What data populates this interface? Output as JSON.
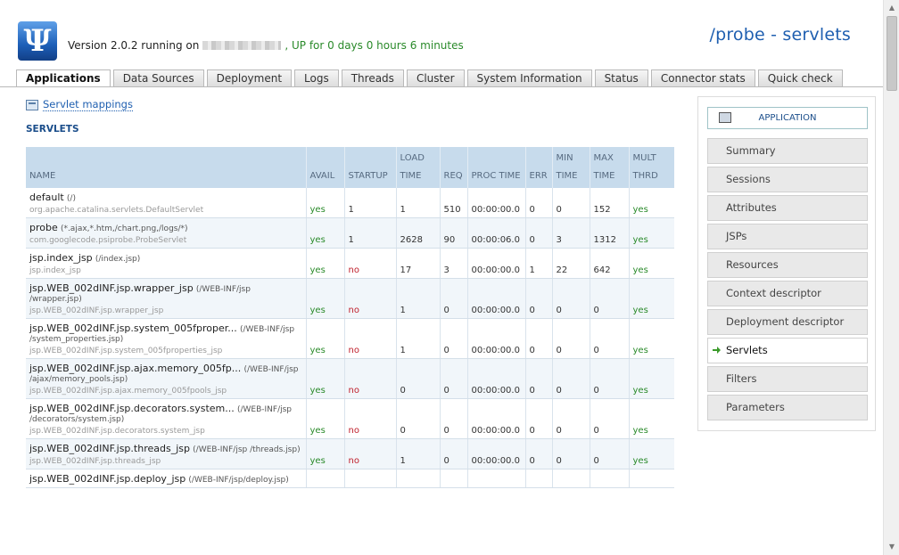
{
  "header": {
    "logo_glyph": "Ψ",
    "version_text": "Version 2.0.2 running on",
    "uptime_text": ", UP for 0 days 0 hours 6 minutes",
    "page_title": "/probe - servlets"
  },
  "tabs": [
    {
      "label": "Applications",
      "active": true
    },
    {
      "label": "Data Sources",
      "active": false
    },
    {
      "label": "Deployment",
      "active": false
    },
    {
      "label": "Logs",
      "active": false
    },
    {
      "label": "Threads",
      "active": false
    },
    {
      "label": "Cluster",
      "active": false
    },
    {
      "label": "System Information",
      "active": false
    },
    {
      "label": "Status",
      "active": false
    },
    {
      "label": "Connector stats",
      "active": false
    },
    {
      "label": "Quick check",
      "active": false
    }
  ],
  "main": {
    "mappings_link": "Servlet mappings",
    "section_title": "SERVLETS",
    "columns": [
      "NAME",
      "AVAIL",
      "STARTUP",
      "LOAD TIME",
      "REQ",
      "PROC TIME",
      "ERR",
      "MIN TIME",
      "MAX TIME",
      "MULT THRD"
    ],
    "rows": [
      {
        "name": "default",
        "mapping": "(/)",
        "cls": "org.apache.catalina.servlets.DefaultServlet",
        "avail": "yes",
        "startup": "1",
        "load": "1",
        "req": "510",
        "proc": "00:00:00.0",
        "err": "0",
        "min": "0",
        "max": "152",
        "mult": "yes"
      },
      {
        "name": "probe",
        "mapping": "(*.ajax,*.htm,/chart.png,/logs/*)",
        "cls": "com.googlecode.psiprobe.ProbeServlet",
        "avail": "yes",
        "startup": "1",
        "load": "2628",
        "req": "90",
        "proc": "00:00:06.0",
        "err": "0",
        "min": "3",
        "max": "1312",
        "mult": "yes"
      },
      {
        "name": "jsp.index_jsp",
        "mapping": "(/index.jsp)",
        "cls": "jsp.index_jsp",
        "avail": "yes",
        "startup": "no",
        "load": "17",
        "req": "3",
        "proc": "00:00:00.0",
        "err": "1",
        "min": "22",
        "max": "642",
        "mult": "yes"
      },
      {
        "name": "jsp.WEB_002dINF.jsp.wrapper_jsp",
        "mapping": "(/WEB-INF/jsp /wrapper.jsp)",
        "cls": "jsp.WEB_002dINF.jsp.wrapper_jsp",
        "avail": "yes",
        "startup": "no",
        "load": "1",
        "req": "0",
        "proc": "00:00:00.0",
        "err": "0",
        "min": "0",
        "max": "0",
        "mult": "yes"
      },
      {
        "name": "jsp.WEB_002dINF.jsp.system_005fproper...",
        "mapping": "(/WEB-INF/jsp /system_properties.jsp)",
        "cls": "jsp.WEB_002dINF.jsp.system_005fproperties_jsp",
        "avail": "yes",
        "startup": "no",
        "load": "1",
        "req": "0",
        "proc": "00:00:00.0",
        "err": "0",
        "min": "0",
        "max": "0",
        "mult": "yes"
      },
      {
        "name": "jsp.WEB_002dINF.jsp.ajax.memory_005fp...",
        "mapping": "(/WEB-INF/jsp /ajax/memory_pools.jsp)",
        "cls": "jsp.WEB_002dINF.jsp.ajax.memory_005fpools_jsp",
        "avail": "yes",
        "startup": "no",
        "load": "0",
        "req": "0",
        "proc": "00:00:00.0",
        "err": "0",
        "min": "0",
        "max": "0",
        "mult": "yes"
      },
      {
        "name": "jsp.WEB_002dINF.jsp.decorators.system...",
        "mapping": "(/WEB-INF/jsp /decorators/system.jsp)",
        "cls": "jsp.WEB_002dINF.jsp.decorators.system_jsp",
        "avail": "yes",
        "startup": "no",
        "load": "0",
        "req": "0",
        "proc": "00:00:00.0",
        "err": "0",
        "min": "0",
        "max": "0",
        "mult": "yes"
      },
      {
        "name": "jsp.WEB_002dINF.jsp.threads_jsp",
        "mapping": "(/WEB-INF/jsp /threads.jsp)",
        "cls": "jsp.WEB_002dINF.jsp.threads_jsp",
        "avail": "yes",
        "startup": "no",
        "load": "1",
        "req": "0",
        "proc": "00:00:00.0",
        "err": "0",
        "min": "0",
        "max": "0",
        "mult": "yes"
      },
      {
        "name": "jsp.WEB_002dINF.jsp.deploy_jsp",
        "mapping": "(/WEB-INF/jsp/deploy.jsp)",
        "cls": "",
        "avail": "",
        "startup": "",
        "load": "",
        "req": "",
        "proc": "",
        "err": "",
        "min": "",
        "max": "",
        "mult": ""
      }
    ]
  },
  "sidebar": {
    "header": "APPLICATION",
    "items": [
      {
        "label": "Summary",
        "active": false
      },
      {
        "label": "Sessions",
        "active": false
      },
      {
        "label": "Attributes",
        "active": false
      },
      {
        "label": "JSPs",
        "active": false
      },
      {
        "label": "Resources",
        "active": false
      },
      {
        "label": "Context descriptor",
        "active": false
      },
      {
        "label": "Deployment descriptor",
        "active": false
      },
      {
        "label": "Servlets",
        "active": true
      },
      {
        "label": "Filters",
        "active": false
      },
      {
        "label": "Parameters",
        "active": false
      }
    ]
  },
  "colors": {
    "accent": "#1f5fb0",
    "yes": "#2a8a2a",
    "no": "#c0222e",
    "table_header": "#c7dbec"
  }
}
